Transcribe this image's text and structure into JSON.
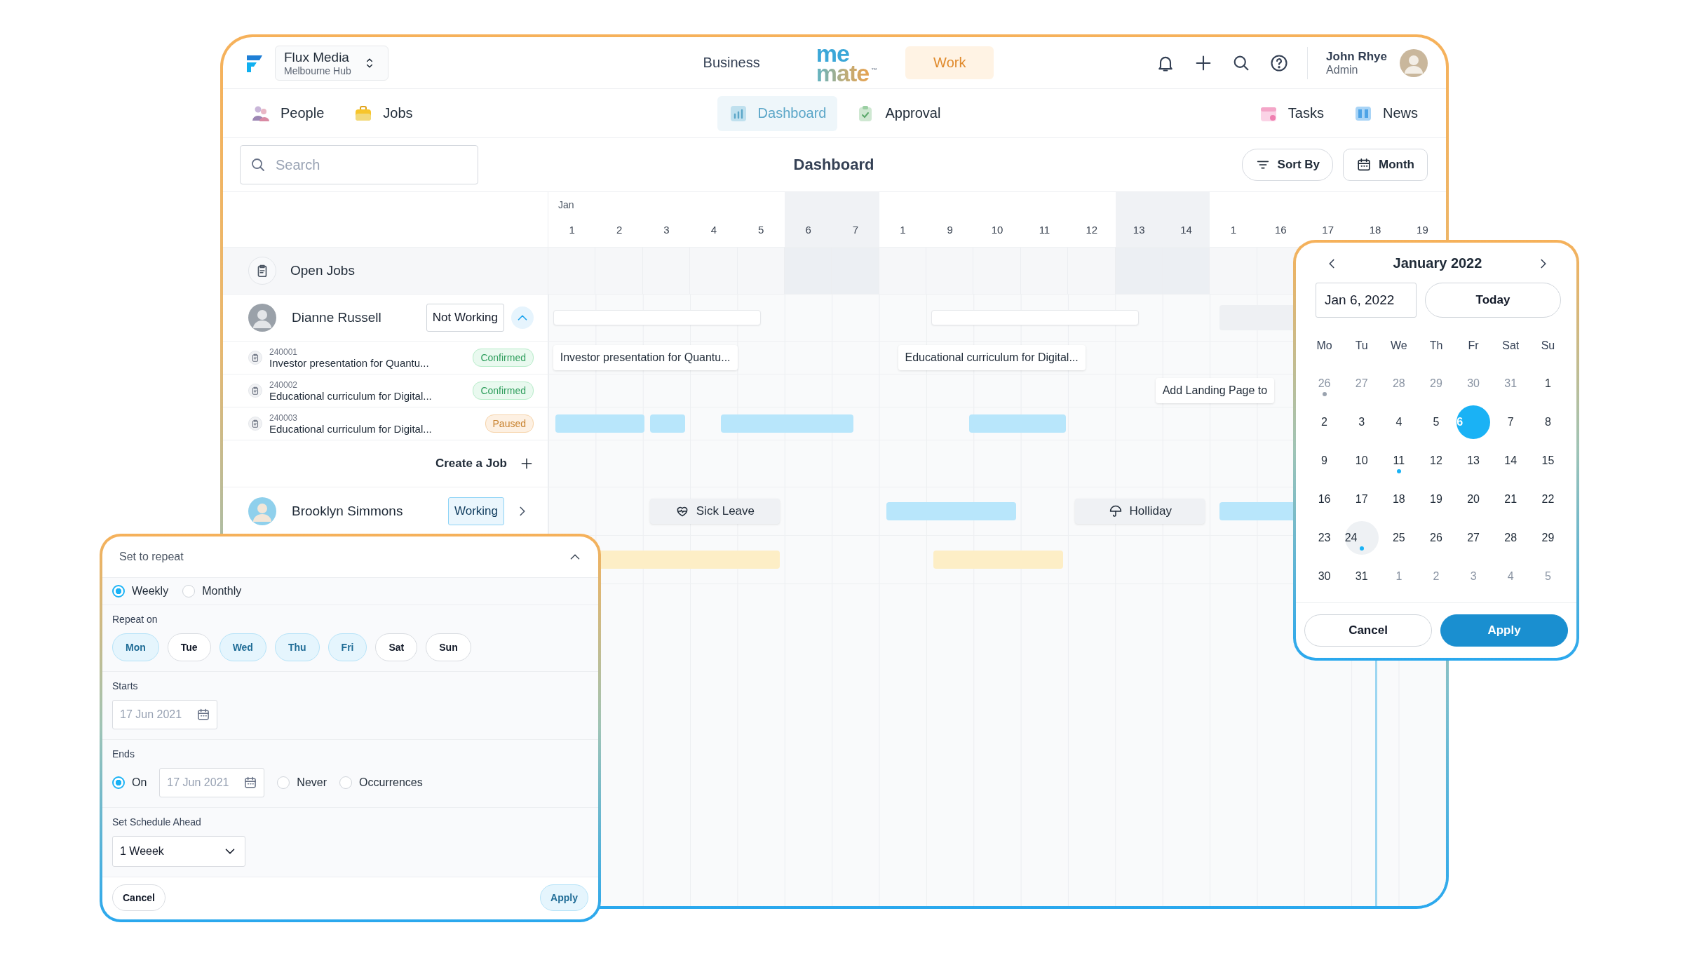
{
  "header": {
    "org": {
      "name": "Flux Media",
      "location": "Melbourne Hub"
    },
    "modes": [
      {
        "label": "Business",
        "selected": false
      },
      {
        "label": "Work",
        "selected": true
      }
    ],
    "logo": {
      "top": "me",
      "bottom": "mate",
      "mark": "™"
    },
    "user": {
      "name": "John Rhye",
      "role": "Admin"
    }
  },
  "nav": {
    "left": [
      {
        "label": "People",
        "kind": "people",
        "selected": false
      },
      {
        "label": "Jobs",
        "kind": "jobs",
        "selected": false
      }
    ],
    "center": [
      {
        "label": "Dashboard",
        "kind": "dashboard",
        "selected": true
      },
      {
        "label": "Approval",
        "kind": "approval",
        "selected": false
      }
    ],
    "right": [
      {
        "label": "Tasks",
        "kind": "tasks",
        "selected": false
      },
      {
        "label": "News",
        "kind": "news",
        "selected": false
      }
    ]
  },
  "toolbar": {
    "search_placeholder": "Search",
    "title": "Dashboard",
    "buttons": [
      {
        "label": "Sort By",
        "kind": "sort"
      },
      {
        "label": "Month",
        "kind": "calendar"
      }
    ]
  },
  "schedule": {
    "month": "Jan",
    "days": [
      {
        "label": "1",
        "weekend": false
      },
      {
        "label": "2",
        "weekend": false
      },
      {
        "label": "3",
        "weekend": false
      },
      {
        "label": "4",
        "weekend": false
      },
      {
        "label": "5",
        "weekend": false
      },
      {
        "label": "6",
        "weekend": true
      },
      {
        "label": "7",
        "weekend": true
      },
      {
        "label": "1",
        "weekend": false
      },
      {
        "label": "9",
        "weekend": false
      },
      {
        "label": "10",
        "weekend": false
      },
      {
        "label": "11",
        "weekend": false
      },
      {
        "label": "12",
        "weekend": false
      },
      {
        "label": "13",
        "weekend": true
      },
      {
        "label": "14",
        "weekend": true
      },
      {
        "label": "1",
        "weekend": false
      },
      {
        "label": "16",
        "weekend": false
      },
      {
        "label": "17",
        "weekend": false
      },
      {
        "label": "18",
        "weekend": false
      },
      {
        "label": "19",
        "weekend": false
      }
    ],
    "open_jobs": "Open Jobs",
    "people": [
      {
        "name": "Dianne Russell",
        "status": "Not Working",
        "kind": "not-working",
        "expanded": true,
        "bars": [
          {
            "kind": "blank"
          },
          {
            "kind": "blank"
          },
          {
            "kind": "grey"
          }
        ],
        "jobs": [
          {
            "number": "240001",
            "title": "Investor presentation for Quantu...",
            "status": "Confirmed",
            "kind": "confirmed",
            "bars": [
              {
                "kind": "label",
                "label": "Investor presentation for Quantu..."
              },
              {
                "kind": "label",
                "label": "Educational curriculum for Digital..."
              }
            ]
          },
          {
            "number": "240002",
            "title": "Educational curriculum for Digital...",
            "status": "Confirmed",
            "kind": "confirmed",
            "bars": [
              {
                "kind": "label",
                "label": "Add Landing Page to"
              }
            ]
          },
          {
            "number": "240003",
            "title": "Educational curriculum for Digital...",
            "status": "Paused",
            "kind": "paused",
            "bars": [
              {
                "kind": "blue"
              },
              {
                "kind": "blue"
              },
              {
                "kind": "blue"
              },
              {
                "kind": "blue"
              }
            ]
          }
        ],
        "create_label": "Create a Job"
      },
      {
        "name": "Brooklyn Simmons",
        "status": "Working",
        "kind": "working",
        "expanded": false,
        "bars": [
          {
            "kind": "sick-leave",
            "label": "Sick Leave"
          },
          {
            "kind": "blue"
          },
          {
            "kind": "holiday",
            "label": "Holliday"
          },
          {
            "kind": "blue"
          }
        ]
      }
    ],
    "trailing_rows": [
      {
        "bars": [
          {
            "kind": "yellow"
          },
          {
            "kind": "yellow"
          }
        ]
      }
    ]
  },
  "repeat_popup": {
    "title": "Set to repeat",
    "frequency": [
      {
        "label": "Weekly",
        "selected": true
      },
      {
        "label": "Monthly",
        "selected": false
      }
    ],
    "repeat_on_label": "Repeat on",
    "days": [
      {
        "label": "Mon",
        "selected": true
      },
      {
        "label": "Tue",
        "selected": false
      },
      {
        "label": "Wed",
        "selected": true
      },
      {
        "label": "Thu",
        "selected": true
      },
      {
        "label": "Fri",
        "selected": true
      },
      {
        "label": "Sat",
        "selected": false
      },
      {
        "label": "Sun",
        "selected": false
      }
    ],
    "starts": {
      "label": "Starts",
      "placeholder": "17 Jun 2021"
    },
    "ends": {
      "label": "Ends",
      "options": [
        {
          "label": "On",
          "selected": true,
          "kind": "date",
          "placeholder": "17 Jun 2021"
        },
        {
          "label": "Never",
          "selected": false,
          "kind": "plain"
        },
        {
          "label": "Occurrences",
          "selected": false,
          "kind": "plain"
        }
      ]
    },
    "schedule_ahead": {
      "label": "Set Schedule Ahead",
      "value": "1 Weeek"
    },
    "buttons": [
      {
        "label": "Cancel",
        "kind": "secondary"
      },
      {
        "label": "Apply",
        "kind": "primary"
      }
    ]
  },
  "date_picker": {
    "title": "January 2022",
    "value": "Jan 6, 2022",
    "today_label": "Today",
    "weekdays": [
      "Mo",
      "Tu",
      "We",
      "Th",
      "Fr",
      "Sat",
      "Su"
    ],
    "days": [
      {
        "label": "26",
        "muted": true,
        "selected": false,
        "highlighted": false,
        "color": "#9aa3af"
      },
      {
        "label": "27",
        "muted": true,
        "selected": false,
        "highlighted": false
      },
      {
        "label": "28",
        "muted": true,
        "selected": false,
        "highlighted": false
      },
      {
        "label": "29",
        "muted": true,
        "selected": false,
        "highlighted": false
      },
      {
        "label": "30",
        "muted": true,
        "selected": false,
        "highlighted": false
      },
      {
        "label": "31",
        "muted": true,
        "selected": false,
        "highlighted": false
      },
      {
        "label": "1",
        "muted": false,
        "selected": false,
        "highlighted": false
      },
      {
        "label": "2",
        "muted": false,
        "selected": false,
        "highlighted": false
      },
      {
        "label": "3",
        "muted": false,
        "selected": false,
        "highlighted": false
      },
      {
        "label": "4",
        "muted": false,
        "selected": false,
        "highlighted": false
      },
      {
        "label": "5",
        "muted": false,
        "selected": false,
        "highlighted": false
      },
      {
        "label": "6",
        "muted": false,
        "selected": true,
        "highlighted": false
      },
      {
        "label": "7",
        "muted": false,
        "selected": false,
        "highlighted": false
      },
      {
        "label": "8",
        "muted": false,
        "selected": false,
        "highlighted": false
      },
      {
        "label": "9",
        "muted": false,
        "selected": false,
        "highlighted": false
      },
      {
        "label": "10",
        "muted": false,
        "selected": false,
        "highlighted": false
      },
      {
        "label": "11",
        "muted": false,
        "selected": false,
        "highlighted": false,
        "color": "#1ab2f5"
      },
      {
        "label": "12",
        "muted": false,
        "selected": false,
        "highlighted": false
      },
      {
        "label": "13",
        "muted": false,
        "selected": false,
        "highlighted": false
      },
      {
        "label": "14",
        "muted": false,
        "selected": false,
        "highlighted": false
      },
      {
        "label": "15",
        "muted": false,
        "selected": false,
        "highlighted": false
      },
      {
        "label": "16",
        "muted": false,
        "selected": false,
        "highlighted": false
      },
      {
        "label": "17",
        "muted": false,
        "selected": false,
        "highlighted": false
      },
      {
        "label": "18",
        "muted": false,
        "selected": false,
        "highlighted": false
      },
      {
        "label": "19",
        "muted": false,
        "selected": false,
        "highlighted": false
      },
      {
        "label": "20",
        "muted": false,
        "selected": false,
        "highlighted": false
      },
      {
        "label": "21",
        "muted": false,
        "selected": false,
        "highlighted": false
      },
      {
        "label": "22",
        "muted": false,
        "selected": false,
        "highlighted": false
      },
      {
        "label": "23",
        "muted": false,
        "selected": false,
        "highlighted": false
      },
      {
        "label": "24",
        "muted": false,
        "selected": false,
        "highlighted": true,
        "color": "#1ab2f5"
      },
      {
        "label": "25",
        "muted": false,
        "selected": false,
        "highlighted": false
      },
      {
        "label": "26",
        "muted": false,
        "selected": false,
        "highlighted": false
      },
      {
        "label": "27",
        "muted": false,
        "selected": false,
        "highlighted": false
      },
      {
        "label": "28",
        "muted": false,
        "selected": false,
        "highlighted": false
      },
      {
        "label": "29",
        "muted": false,
        "selected": false,
        "highlighted": false
      },
      {
        "label": "30",
        "muted": false,
        "selected": false,
        "highlighted": false
      },
      {
        "label": "31",
        "muted": false,
        "selected": false,
        "highlighted": false
      },
      {
        "label": "1",
        "muted": true,
        "selected": false,
        "highlighted": false
      },
      {
        "label": "2",
        "muted": true,
        "selected": false,
        "highlighted": false
      },
      {
        "label": "3",
        "muted": true,
        "selected": false,
        "highlighted": false
      },
      {
        "label": "4",
        "muted": true,
        "selected": false,
        "highlighted": false
      },
      {
        "label": "5",
        "muted": true,
        "selected": false,
        "highlighted": false
      }
    ],
    "buttons": [
      {
        "label": "Cancel",
        "kind": "secondary"
      },
      {
        "label": "Apply",
        "kind": "primary"
      }
    ]
  }
}
